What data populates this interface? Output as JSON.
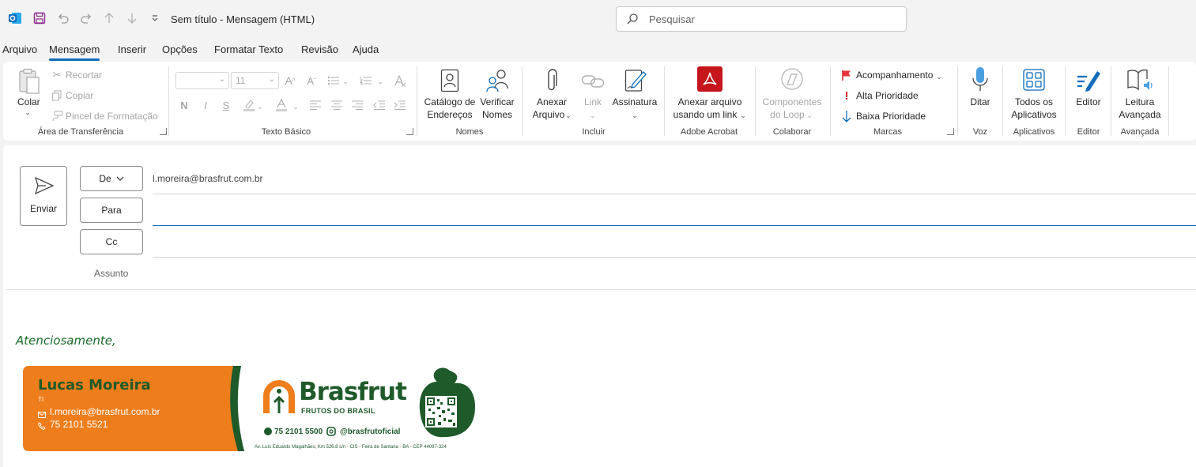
{
  "window": {
    "title": "Sem título  -  Mensagem (HTML)",
    "search_placeholder": "Pesquisar"
  },
  "menu_tabs": [
    "Arquivo",
    "Mensagem",
    "Inserir",
    "Opções",
    "Formatar Texto",
    "Revisão",
    "Ajuda"
  ],
  "active_tab": "Mensagem",
  "ribbon": {
    "clipboard": {
      "paste": "Colar",
      "cut": "Recortar",
      "copy": "Copiar",
      "format_painter": "Pincel de Formatação",
      "group": "Área de Transferência"
    },
    "basic_text": {
      "font_size": "11",
      "group": "Texto Básico"
    },
    "names": {
      "address_book_1": "Catálogo de",
      "address_book_2": "Endereços",
      "check_names_1": "Verificar",
      "check_names_2": "Nomes",
      "group": "Nomes"
    },
    "include": {
      "attach_1": "Anexar",
      "attach_2": "Arquivo",
      "link": "Link",
      "signature": "Assinatura",
      "group": "Incluir"
    },
    "adobe": {
      "attach_link_1": "Anexar arquivo",
      "attach_link_2": "usando um link",
      "group": "Adobe Acrobat"
    },
    "collaborate": {
      "loop_1": "Componentes",
      "loop_2": "do Loop",
      "group": "Colaborar"
    },
    "tags": {
      "follow_up": "Acompanhamento",
      "high": "Alta Prioridade",
      "low": "Baixa Prioridade",
      "group": "Marcas"
    },
    "voice": {
      "dictate": "Ditar",
      "group": "Voz"
    },
    "apps": {
      "all_apps_1": "Todos os",
      "all_apps_2": "Aplicativos",
      "group": "Aplicativos"
    },
    "editor": {
      "editor": "Editor",
      "group": "Editor"
    },
    "immersive": {
      "reader_1": "Leitura",
      "reader_2": "Avançada",
      "group": "Avançada"
    }
  },
  "compose": {
    "send": "Enviar",
    "from_label": "De",
    "from_value": "l.moreira@brasfrut.com.br",
    "to_label": "Para",
    "to_value": "",
    "cc_label": "Cc",
    "cc_value": "",
    "subject_placeholder": "Assunto"
  },
  "body": {
    "closing": "Atenciosamente,",
    "signature": {
      "name": "Lucas Moreira",
      "department": "TI",
      "email": "l.moreira@brasfrut.com.br",
      "phone": "75 2101 5521",
      "brand": "Brasfrut",
      "brand_tagline": "FRUTOS DO BRASIL",
      "company_phone": "75 2101 5500",
      "instagram": "@brasfrutoficial",
      "address": "Av. Luís Eduardo Magalhães, Km 526.8 s/n - CIS - Feira de Santana - BA - CEP 44097-324"
    }
  },
  "colors": {
    "accent": "#0f6cbd",
    "signature_orange": "#ee7d1b",
    "signature_green": "#1e5a2a",
    "closing_green": "#1b6b2a",
    "adobe_red": "#c4161c"
  }
}
